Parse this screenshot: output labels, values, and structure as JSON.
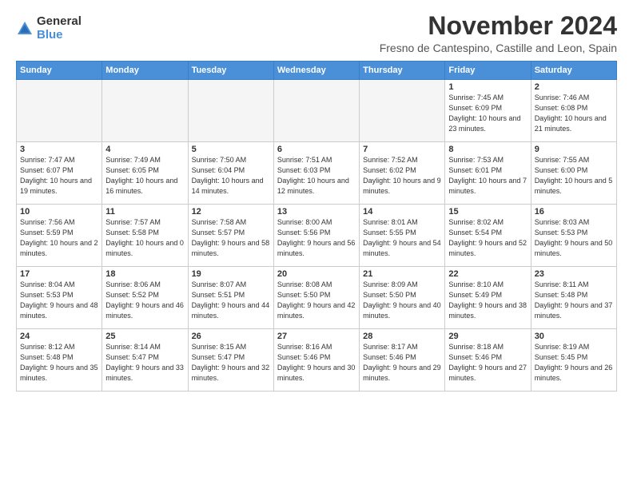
{
  "logo": {
    "general": "General",
    "blue": "Blue"
  },
  "title": "November 2024",
  "location": "Fresno de Cantespino, Castille and Leon, Spain",
  "headers": [
    "Sunday",
    "Monday",
    "Tuesday",
    "Wednesday",
    "Thursday",
    "Friday",
    "Saturday"
  ],
  "weeks": [
    [
      {
        "day": "",
        "info": ""
      },
      {
        "day": "",
        "info": ""
      },
      {
        "day": "",
        "info": ""
      },
      {
        "day": "",
        "info": ""
      },
      {
        "day": "",
        "info": ""
      },
      {
        "day": "1",
        "info": "Sunrise: 7:45 AM\nSunset: 6:09 PM\nDaylight: 10 hours\nand 23 minutes."
      },
      {
        "day": "2",
        "info": "Sunrise: 7:46 AM\nSunset: 6:08 PM\nDaylight: 10 hours\nand 21 minutes."
      }
    ],
    [
      {
        "day": "3",
        "info": "Sunrise: 7:47 AM\nSunset: 6:07 PM\nDaylight: 10 hours\nand 19 minutes."
      },
      {
        "day": "4",
        "info": "Sunrise: 7:49 AM\nSunset: 6:05 PM\nDaylight: 10 hours\nand 16 minutes."
      },
      {
        "day": "5",
        "info": "Sunrise: 7:50 AM\nSunset: 6:04 PM\nDaylight: 10 hours\nand 14 minutes."
      },
      {
        "day": "6",
        "info": "Sunrise: 7:51 AM\nSunset: 6:03 PM\nDaylight: 10 hours\nand 12 minutes."
      },
      {
        "day": "7",
        "info": "Sunrise: 7:52 AM\nSunset: 6:02 PM\nDaylight: 10 hours\nand 9 minutes."
      },
      {
        "day": "8",
        "info": "Sunrise: 7:53 AM\nSunset: 6:01 PM\nDaylight: 10 hours\nand 7 minutes."
      },
      {
        "day": "9",
        "info": "Sunrise: 7:55 AM\nSunset: 6:00 PM\nDaylight: 10 hours\nand 5 minutes."
      }
    ],
    [
      {
        "day": "10",
        "info": "Sunrise: 7:56 AM\nSunset: 5:59 PM\nDaylight: 10 hours\nand 2 minutes."
      },
      {
        "day": "11",
        "info": "Sunrise: 7:57 AM\nSunset: 5:58 PM\nDaylight: 10 hours\nand 0 minutes."
      },
      {
        "day": "12",
        "info": "Sunrise: 7:58 AM\nSunset: 5:57 PM\nDaylight: 9 hours\nand 58 minutes."
      },
      {
        "day": "13",
        "info": "Sunrise: 8:00 AM\nSunset: 5:56 PM\nDaylight: 9 hours\nand 56 minutes."
      },
      {
        "day": "14",
        "info": "Sunrise: 8:01 AM\nSunset: 5:55 PM\nDaylight: 9 hours\nand 54 minutes."
      },
      {
        "day": "15",
        "info": "Sunrise: 8:02 AM\nSunset: 5:54 PM\nDaylight: 9 hours\nand 52 minutes."
      },
      {
        "day": "16",
        "info": "Sunrise: 8:03 AM\nSunset: 5:53 PM\nDaylight: 9 hours\nand 50 minutes."
      }
    ],
    [
      {
        "day": "17",
        "info": "Sunrise: 8:04 AM\nSunset: 5:53 PM\nDaylight: 9 hours\nand 48 minutes."
      },
      {
        "day": "18",
        "info": "Sunrise: 8:06 AM\nSunset: 5:52 PM\nDaylight: 9 hours\nand 46 minutes."
      },
      {
        "day": "19",
        "info": "Sunrise: 8:07 AM\nSunset: 5:51 PM\nDaylight: 9 hours\nand 44 minutes."
      },
      {
        "day": "20",
        "info": "Sunrise: 8:08 AM\nSunset: 5:50 PM\nDaylight: 9 hours\nand 42 minutes."
      },
      {
        "day": "21",
        "info": "Sunrise: 8:09 AM\nSunset: 5:50 PM\nDaylight: 9 hours\nand 40 minutes."
      },
      {
        "day": "22",
        "info": "Sunrise: 8:10 AM\nSunset: 5:49 PM\nDaylight: 9 hours\nand 38 minutes."
      },
      {
        "day": "23",
        "info": "Sunrise: 8:11 AM\nSunset: 5:48 PM\nDaylight: 9 hours\nand 37 minutes."
      }
    ],
    [
      {
        "day": "24",
        "info": "Sunrise: 8:12 AM\nSunset: 5:48 PM\nDaylight: 9 hours\nand 35 minutes."
      },
      {
        "day": "25",
        "info": "Sunrise: 8:14 AM\nSunset: 5:47 PM\nDaylight: 9 hours\nand 33 minutes."
      },
      {
        "day": "26",
        "info": "Sunrise: 8:15 AM\nSunset: 5:47 PM\nDaylight: 9 hours\nand 32 minutes."
      },
      {
        "day": "27",
        "info": "Sunrise: 8:16 AM\nSunset: 5:46 PM\nDaylight: 9 hours\nand 30 minutes."
      },
      {
        "day": "28",
        "info": "Sunrise: 8:17 AM\nSunset: 5:46 PM\nDaylight: 9 hours\nand 29 minutes."
      },
      {
        "day": "29",
        "info": "Sunrise: 8:18 AM\nSunset: 5:46 PM\nDaylight: 9 hours\nand 27 minutes."
      },
      {
        "day": "30",
        "info": "Sunrise: 8:19 AM\nSunset: 5:45 PM\nDaylight: 9 hours\nand 26 minutes."
      }
    ]
  ]
}
